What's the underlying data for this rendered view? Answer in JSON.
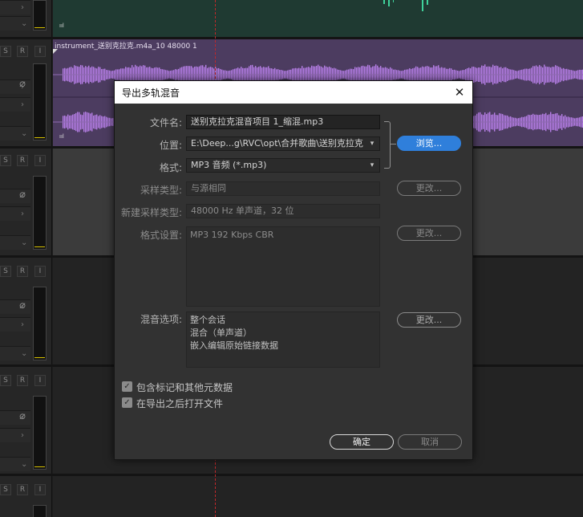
{
  "dialog": {
    "title": "导出多轨混音",
    "close_glyph": "✕",
    "filename_label": "文件名:",
    "filename_value": "送别克拉克混音项目 1_缩混.mp3",
    "location_label": "位置:",
    "location_value": "E:\\Deep...g\\RVC\\opt\\合并歌曲\\送别克拉克",
    "format_label": "格式:",
    "format_value": "MP3 音频 (*.mp3)",
    "browse_label": "浏览...",
    "sample_type_label": "采样类型:",
    "sample_type_value": "与源相同",
    "new_sample_type_label": "新建采样类型:",
    "new_sample_type_value": "48000 Hz 单声道，32 位",
    "format_settings_label": "格式设置:",
    "format_settings_value": "MP3 192 Kbps CBR",
    "mix_options_label": "混音选项:",
    "mix_options_lines": [
      "整个会话",
      "混合（单声道）",
      "嵌入编辑原始链接数据"
    ],
    "change_label": "更改...",
    "include_markers_label": "包含标记和其他元数据",
    "open_after_export_label": "在导出之后打开文件",
    "ok_label": "确定",
    "cancel_label": "取消"
  },
  "editor": {
    "clip_name": "instrument_送别克拉克.m4a_10 48000 1",
    "track_buttons": [
      "S",
      "R",
      "I"
    ],
    "colors": {
      "clip_purple": "#4c3c60",
      "waveform_purple": "#b77fe8",
      "waveform_teal": "#3fd29b",
      "meter_level": "#d6c000",
      "accent_blue": "#2f7fdb",
      "playhead": "#c0282b"
    }
  }
}
